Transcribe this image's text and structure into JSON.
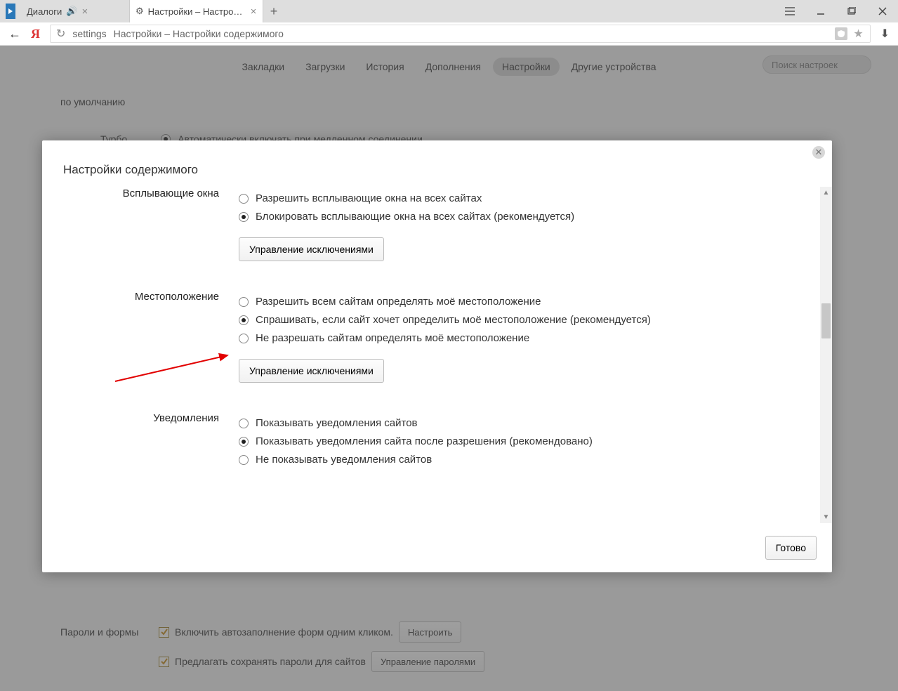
{
  "titlebar": {
    "tabs": [
      {
        "title": "Диалоги",
        "has_audio": true
      },
      {
        "title": "Настройки – Настройки",
        "has_audio": false
      }
    ]
  },
  "addressbar": {
    "protocol": "settings",
    "path_display": "Настройки – Настройки содержимого"
  },
  "nav": {
    "items": [
      "Закладки",
      "Загрузки",
      "История",
      "Дополнения",
      "Настройки",
      "Другие устройства"
    ],
    "active_index": 4,
    "search_placeholder": "Поиск настроек"
  },
  "background": {
    "label_default": "по умолчанию",
    "turbo_label": "Турбо",
    "turbo_option": "Автоматически включать при медленном соединении",
    "pw_section": "Пароли и формы",
    "pw_autofill": "Включить автозаполнение форм одним кликом.",
    "pw_configure": "Настроить",
    "pw_save": "Предлагать сохранять пароли для сайтов",
    "pw_manage": "Управление паролями"
  },
  "modal": {
    "title": "Настройки содержимого",
    "done": "Готово",
    "manage_exceptions": "Управление исключениями",
    "sections": [
      {
        "label": "Всплывающие окна",
        "options": [
          "Разрешить всплывающие окна на всех сайтах",
          "Блокировать всплывающие окна на всех сайтах (рекомендуется)"
        ],
        "selected": 1,
        "show_manage": true
      },
      {
        "label": "Местоположение",
        "options": [
          "Разрешить всем сайтам определять моё местоположение",
          "Спрашивать, если сайт хочет определить моё местоположение (рекомендуется)",
          "Не разрешать сайтам определять моё местоположение"
        ],
        "selected": 1,
        "show_manage": true
      },
      {
        "label": "Уведомления",
        "options": [
          "Показывать уведомления сайтов",
          "Показывать уведомления сайта после разрешения (рекомендовано)",
          "Не показывать уведомления сайтов"
        ],
        "selected": 1,
        "show_manage": false
      }
    ]
  }
}
